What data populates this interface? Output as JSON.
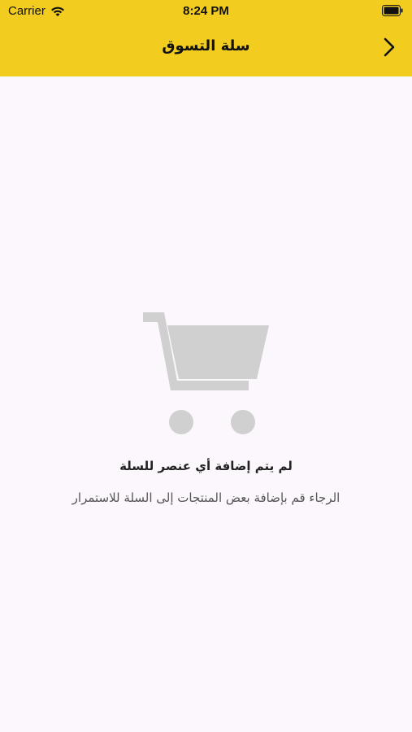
{
  "status_bar": {
    "carrier": "Carrier",
    "time": "8:24 PM",
    "wifi_icon": "wifi-icon",
    "battery_icon": "battery-icon"
  },
  "nav": {
    "title": "سلة التسوق",
    "back_icon": "chevron-right-icon"
  },
  "empty_state": {
    "icon": "cart-icon",
    "title": "لم يتم إضافة أي عنصر للسلة",
    "message": "الرجاء قم بإضافة بعض المنتجات إلى السلة للاستمرار"
  },
  "colors": {
    "header_background": "#f2cc1f",
    "page_background": "#fcf7fc",
    "cart_icon": "#d0d0d0"
  }
}
